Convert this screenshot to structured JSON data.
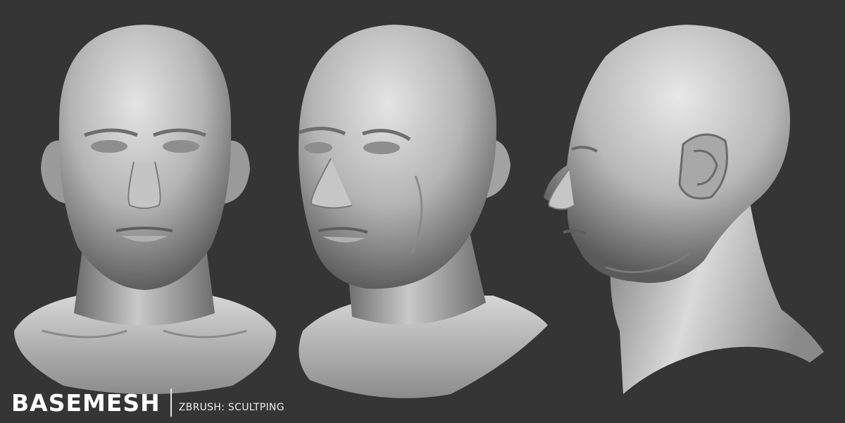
{
  "caption": {
    "title": "BASEMESH",
    "subtitle": "ZBRUSH: SCULTPING"
  },
  "colors": {
    "background": "#353535",
    "clay_light": "#e8e8e8",
    "clay_mid": "#a9a9a9",
    "clay_dark": "#4e4e4e",
    "caption_text": "#ffffff"
  },
  "views": [
    "front-view",
    "three-quarter-view",
    "side-profile-view"
  ]
}
